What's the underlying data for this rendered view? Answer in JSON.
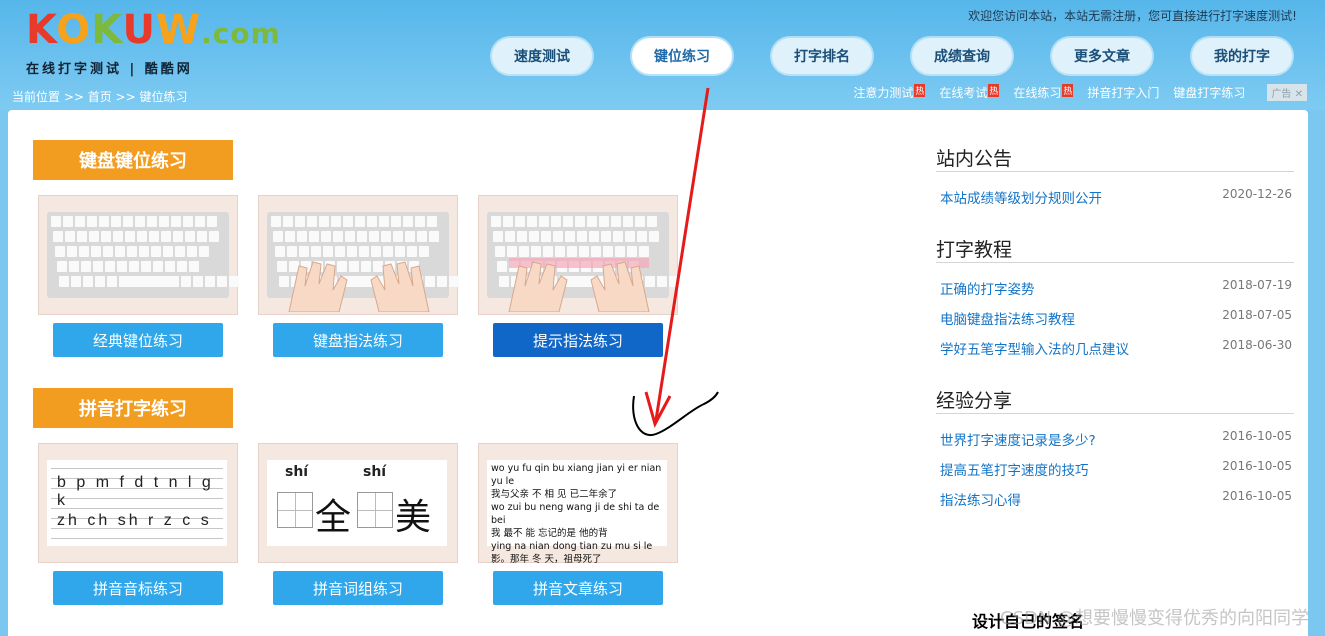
{
  "logo": {
    "letters": [
      "K",
      "O",
      "K",
      "U",
      "W"
    ],
    "com": ".com",
    "subtitle": "在线打字测试 | 酷酷网"
  },
  "welcome": "欢迎您访问本站，本站无需注册，您可直接进行打字速度测试!",
  "nav": [
    "速度测试",
    "键位练习",
    "打字排名",
    "成绩查询",
    "更多文章",
    "我的打字"
  ],
  "breadcrumb": "当前位置 >> 首页 >> 键位练习",
  "toplinks": {
    "items": [
      "注意力测试",
      "在线考试",
      "在线练习",
      "拼音打字入门",
      "键盘打字练习"
    ],
    "hot": "热",
    "ad": "广告"
  },
  "sections": [
    {
      "title": "键盘键位练习",
      "buttons": [
        "经典键位练习",
        "键盘指法练习",
        "提示指法练习"
      ]
    },
    {
      "title": "拼音打字练习",
      "buttons": [
        "拼音音标练习",
        "拼音词组练习",
        "拼音文章练习"
      ]
    }
  ],
  "pinyin_card": {
    "row1": "b p m f   d t n l   g k",
    "row2": "zh ch sh r   z c s"
  },
  "word_card": {
    "py1": "shí",
    "py2": "shí",
    "c1": "全",
    "c2": "美"
  },
  "article_card": [
    "wo yu fu qin bu xiang jian yi er nian yu le",
    "我与父亲 不 相  见 已二年余了",
    "wo zui bu neng wang ji de shi ta de bei",
    "我 最不 能  忘记的是 他的背",
    "ying   na nian dong tian    zu mu si le",
    "影。那年   冬  天，祖母死了"
  ],
  "sidebar": {
    "announce": {
      "title": "站内公告",
      "items": [
        {
          "t": "本站成绩等级划分规则公开",
          "d": "2020-12-26"
        }
      ]
    },
    "tutorial": {
      "title": "打字教程",
      "items": [
        {
          "t": "正确的打字姿势",
          "d": "2018-07-19"
        },
        {
          "t": "电脑键盘指法练习教程",
          "d": "2018-07-05"
        },
        {
          "t": "学好五笔字型输入法的几点建议",
          "d": "2018-06-30"
        }
      ]
    },
    "share": {
      "title": "经验分享",
      "items": [
        {
          "t": "世界打字速度记录是多少?",
          "d": "2016-10-05"
        },
        {
          "t": "提高五笔打字速度的技巧",
          "d": "2016-10-05"
        },
        {
          "t": "指法练习心得",
          "d": "2016-10-05"
        }
      ]
    }
  },
  "footer_sig": "设计自己的签名",
  "watermark": "CSDN @想要慢慢变得优秀的向阳同学"
}
